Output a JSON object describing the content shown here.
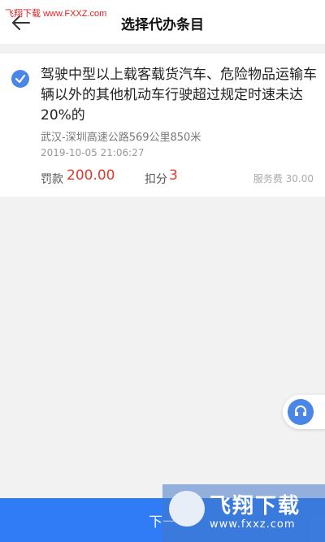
{
  "watermark_top": {
    "site_name": "飞翔下载",
    "url": "www.FXXZ.com"
  },
  "header": {
    "title": "选择代办条目"
  },
  "violation": {
    "description": "驾驶中型以上载客载货汽车、危险物品运输车辆以外的其他机动车行驶超过规定时速未达20%的",
    "location": "武汉-深圳高速公路569公里850米",
    "time": "2019-10-05 21:06:27",
    "fine_label": "罚款",
    "fine_value": "200.00",
    "points_label": "扣分",
    "points_value": "3",
    "service_fee": "服务费 30.00",
    "selected": true
  },
  "bottom": {
    "next_label": "下一"
  },
  "watermark_bottom": {
    "brand": "飞翔下载",
    "url": "www.fxxz.com"
  },
  "colors": {
    "accent": "#2f7cf6",
    "check": "#4a86e8",
    "price": "#e03a2e"
  }
}
